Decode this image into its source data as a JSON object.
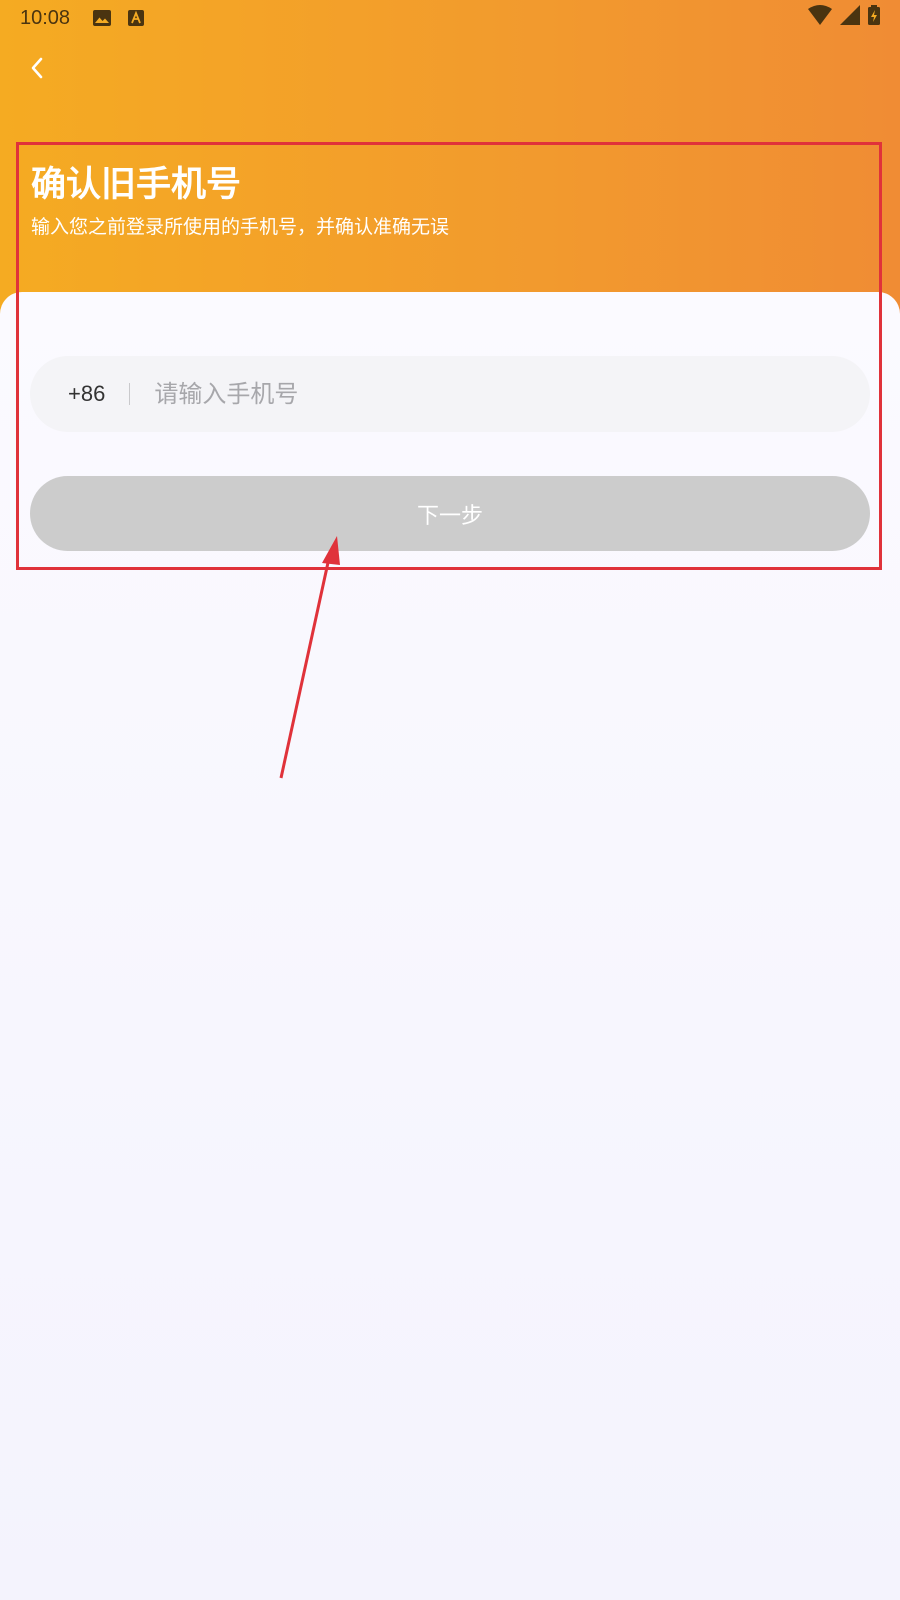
{
  "status_bar": {
    "time": "10:08",
    "icons": [
      "image-icon",
      "text-a-icon",
      "wifi-icon",
      "signal-icon",
      "battery-charging-icon"
    ]
  },
  "nav": {
    "back_icon": "chevron-left-icon"
  },
  "header": {
    "title": "确认旧手机号",
    "subtitle": "输入您之前登录所使用的手机号，并确认准确无误"
  },
  "form": {
    "country_code": "+86",
    "phone_placeholder": "请输入手机号",
    "phone_value": "",
    "next_label": "下一步"
  },
  "colors": {
    "header_gradient_start": "#f5ab22",
    "header_gradient_end": "#f08c34",
    "button_disabled": "#cccccc",
    "annotation": "#e0323a"
  }
}
